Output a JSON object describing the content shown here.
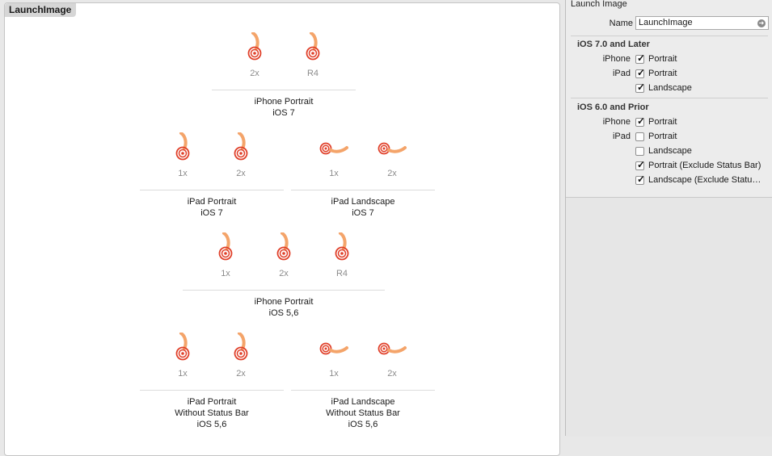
{
  "canvas": {
    "title": "LaunchImage"
  },
  "groups": [
    {
      "id": "iphone-portrait-ios7",
      "slots": [
        "2x",
        "R4"
      ],
      "orient": [
        "portrait",
        "portrait"
      ],
      "lines": [
        "iPhone Portrait",
        "iOS 7"
      ]
    },
    {
      "id": "ipad-portrait-ios7",
      "slots": [
        "1x",
        "2x"
      ],
      "orient": [
        "portrait",
        "portrait"
      ],
      "lines": [
        "iPad Portrait",
        "iOS 7"
      ]
    },
    {
      "id": "ipad-landscape-ios7",
      "slots": [
        "1x",
        "2x"
      ],
      "orient": [
        "landscape",
        "landscape"
      ],
      "lines": [
        "iPad Landscape",
        "iOS 7"
      ]
    },
    {
      "id": "iphone-portrait-ios56",
      "slots": [
        "1x",
        "2x",
        "R4"
      ],
      "orient": [
        "portrait",
        "portrait",
        "portrait"
      ],
      "lines": [
        "iPhone Portrait",
        "iOS 5,6"
      ]
    },
    {
      "id": "ipad-portrait-nostatus",
      "slots": [
        "1x",
        "2x"
      ],
      "orient": [
        "portrait",
        "portrait"
      ],
      "lines": [
        "iPad Portrait",
        "Without Status Bar",
        "iOS 5,6"
      ]
    },
    {
      "id": "ipad-landscape-nostatus",
      "slots": [
        "1x",
        "2x"
      ],
      "orient": [
        "landscape",
        "landscape"
      ],
      "lines": [
        "iPad Landscape",
        "Without Status Bar",
        "iOS 5,6"
      ]
    }
  ],
  "inspector": {
    "header": "Launch Image",
    "name_label": "Name",
    "name_value": "LaunchImage",
    "ios7": {
      "title": "iOS 7.0 and Later",
      "options": [
        {
          "device": "iPhone",
          "label": "Portrait",
          "checked": true
        },
        {
          "device": "iPad",
          "label": "Portrait",
          "checked": true
        },
        {
          "device": "",
          "label": "Landscape",
          "checked": true
        }
      ]
    },
    "ios6": {
      "title": "iOS 6.0 and Prior",
      "options": [
        {
          "device": "iPhone",
          "label": "Portrait",
          "checked": true
        },
        {
          "device": "iPad",
          "label": "Portrait",
          "checked": false
        },
        {
          "device": "",
          "label": "Landscape",
          "checked": false
        },
        {
          "device": "",
          "label": "Portrait (Exclude Status Bar)",
          "checked": true
        },
        {
          "device": "",
          "label": "Landscape (Exclude Statu…",
          "checked": true
        }
      ]
    }
  },
  "colors": {
    "icon_red": "#e0402a",
    "icon_orange": "#f4a46a"
  }
}
